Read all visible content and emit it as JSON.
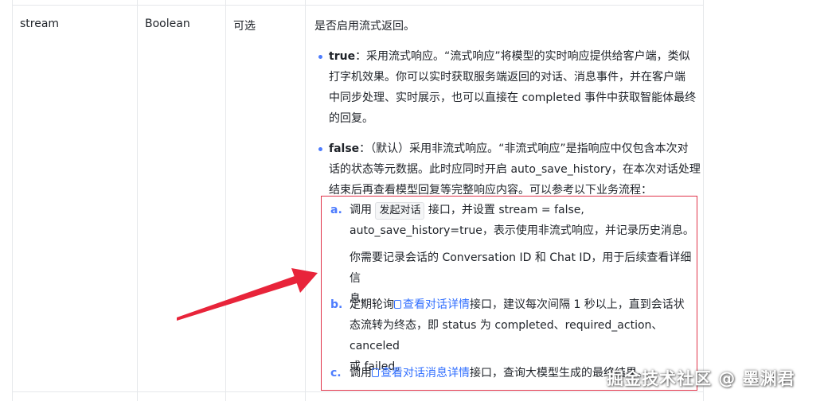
{
  "row": {
    "param": "stream",
    "type": "Boolean",
    "required": "可选",
    "summary": "是否启用流式返回。",
    "true_item": {
      "key": "true",
      "l1": "：采用流式响应。“流式响应”将模型的实时响应提供给客户端，类似",
      "l2": "打字机效果。你可以实时获取服务端返回的对话、消息事件，并在客户端",
      "l3": "中同步处理、实时展示，也可以直接在 completed 事件中获取智能体最终",
      "l4": "的回复。"
    },
    "false_item": {
      "key": "false",
      "l1": "：（默认）采用非流式响应。“非流式响应”是指响应中仅包含本次对",
      "l2": "话的状态等元数据。此时应同时开启 auto_save_history，在本次对话处理",
      "l3": "结束后再查看模型回复等完整响应内容。可以参考以下业务流程："
    },
    "steps": {
      "a": {
        "marker": "a.",
        "pre": "调用",
        "tag": "发起对话",
        "post": "接口，并设置 stream = false,",
        "l2": "auto_save_history=true，表示使用非流式响应，并记录历史消息。",
        "note1": "你需要记录会话的 Conversation ID 和 Chat ID，用于后续查看详细信",
        "note2": "息。"
      },
      "b": {
        "marker": "b.",
        "pre": "定期轮询",
        "link": "查看对话详情",
        "post": "接口，建议每次间隔 1 秒以上，直到会话状",
        "l2": "态流转为终态，即 status 为 completed、required_action、canceled",
        "l3": "或 failed。"
      },
      "c": {
        "marker": "c.",
        "pre": "调用",
        "link": "查看对话消息详情",
        "post": "接口，查询大模型生成的最终结果。"
      }
    }
  },
  "watermark": "掘金技术社区 @ 墨渊君",
  "colors": {
    "accent": "#3370ff",
    "highlight_box": "#e0344a",
    "arrow": "#e8243a",
    "border": "#e6e8eb"
  }
}
